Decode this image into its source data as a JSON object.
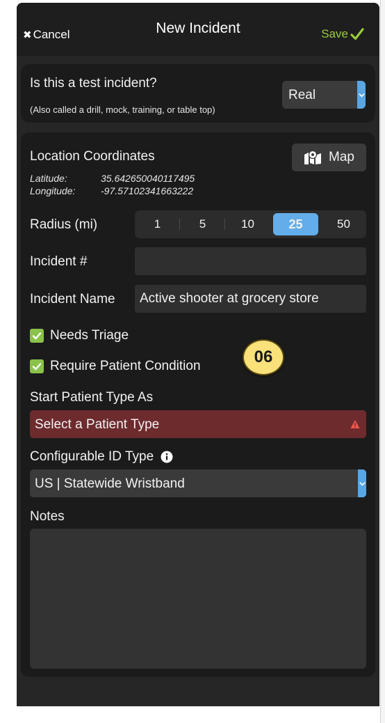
{
  "header": {
    "cancel_label": "Cancel",
    "title": "New Incident",
    "save_label": "Save",
    "save_color": "#9acc3a"
  },
  "test_incident": {
    "question": "Is this a test incident?",
    "subtitle": "(Also called a drill, mock, training, or table top)",
    "selected": "Real"
  },
  "location": {
    "title": "Location Coordinates",
    "map_label": "Map",
    "latitude_label": "Latitude:",
    "latitude": "35.642650040117495",
    "longitude_label": "Longitude:",
    "longitude": "-97.57102341663222"
  },
  "radius": {
    "label": "Radius (mi)",
    "options": [
      "1",
      "5",
      "10",
      "25",
      "50"
    ],
    "selected": "25",
    "accent_color": "#63aeea"
  },
  "incident_number": {
    "label": "Incident #",
    "value": ""
  },
  "incident_name": {
    "label": "Incident Name",
    "value": "Active shooter at grocery store"
  },
  "checks": {
    "needs_triage": "Needs Triage",
    "require_condition": "Require Patient Condition"
  },
  "step_badge": "06",
  "patient_type": {
    "label": "Start Patient Type As",
    "placeholder": "Select a Patient Type",
    "error_color": "#6e2b2e"
  },
  "id_type": {
    "label": "Configurable ID Type",
    "selected": "US | Statewide Wristband"
  },
  "notes": {
    "label": "Notes",
    "value": ""
  },
  "icons": [
    "close-icon",
    "checkmark-icon",
    "chevron-down-icon",
    "map-marker-icon",
    "checkbox-checked-icon",
    "warning-icon",
    "info-icon"
  ]
}
